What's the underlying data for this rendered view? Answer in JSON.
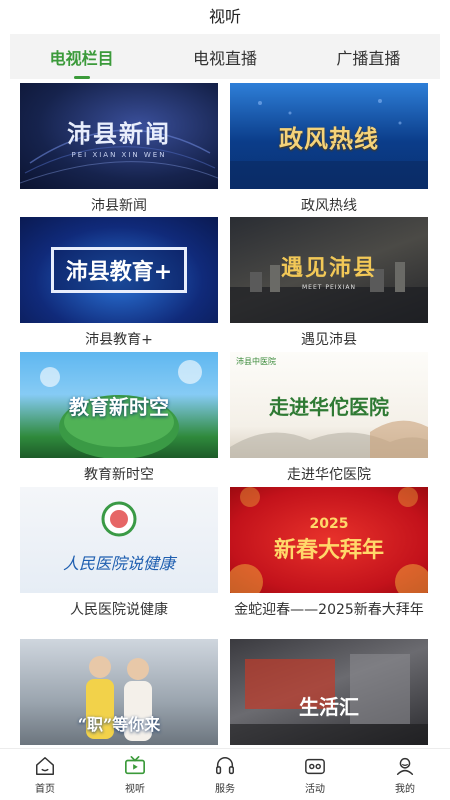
{
  "header": {
    "title": "视听"
  },
  "tabs": [
    {
      "label": "电视栏目",
      "active": true
    },
    {
      "label": "电视直播",
      "active": false
    },
    {
      "label": "广播直播",
      "active": false
    }
  ],
  "programs": [
    {
      "caption": "沛县新闻",
      "thumb_title": "沛县新闻",
      "thumb_subtitle": "PEI XIAN XIN WEN"
    },
    {
      "caption": "政风热线",
      "thumb_title": "政风热线"
    },
    {
      "caption": "沛县教育+",
      "thumb_title": "沛县教育+"
    },
    {
      "caption": "遇见沛县",
      "thumb_title": "遇见沛县",
      "thumb_subtitle": "MEET PEIXIAN"
    },
    {
      "caption": "教育新时空",
      "thumb_title": "教育新时空"
    },
    {
      "caption": "走进华佗医院",
      "thumb_title": "走进华佗医院",
      "thumb_logo_text": "沛县中医院"
    },
    {
      "caption": "人民医院说健康",
      "thumb_title": "人民医院说健康"
    },
    {
      "caption": "金蛇迎春——2025新春大拜年",
      "thumb_title": "新春大拜年",
      "thumb_year": "2025"
    },
    {
      "caption": "",
      "thumb_title": "“职”等你来"
    },
    {
      "caption": "",
      "thumb_title": "生活汇"
    }
  ],
  "tabbar": [
    {
      "label": "首页",
      "icon": "home-icon",
      "active": false
    },
    {
      "label": "视听",
      "icon": "tv-icon",
      "active": true
    },
    {
      "label": "服务",
      "icon": "headset-icon",
      "active": false
    },
    {
      "label": "活动",
      "icon": "activity-icon",
      "active": false
    },
    {
      "label": "我的",
      "icon": "user-icon",
      "active": false
    }
  ],
  "colors": {
    "accent": "#3b9a3a"
  }
}
